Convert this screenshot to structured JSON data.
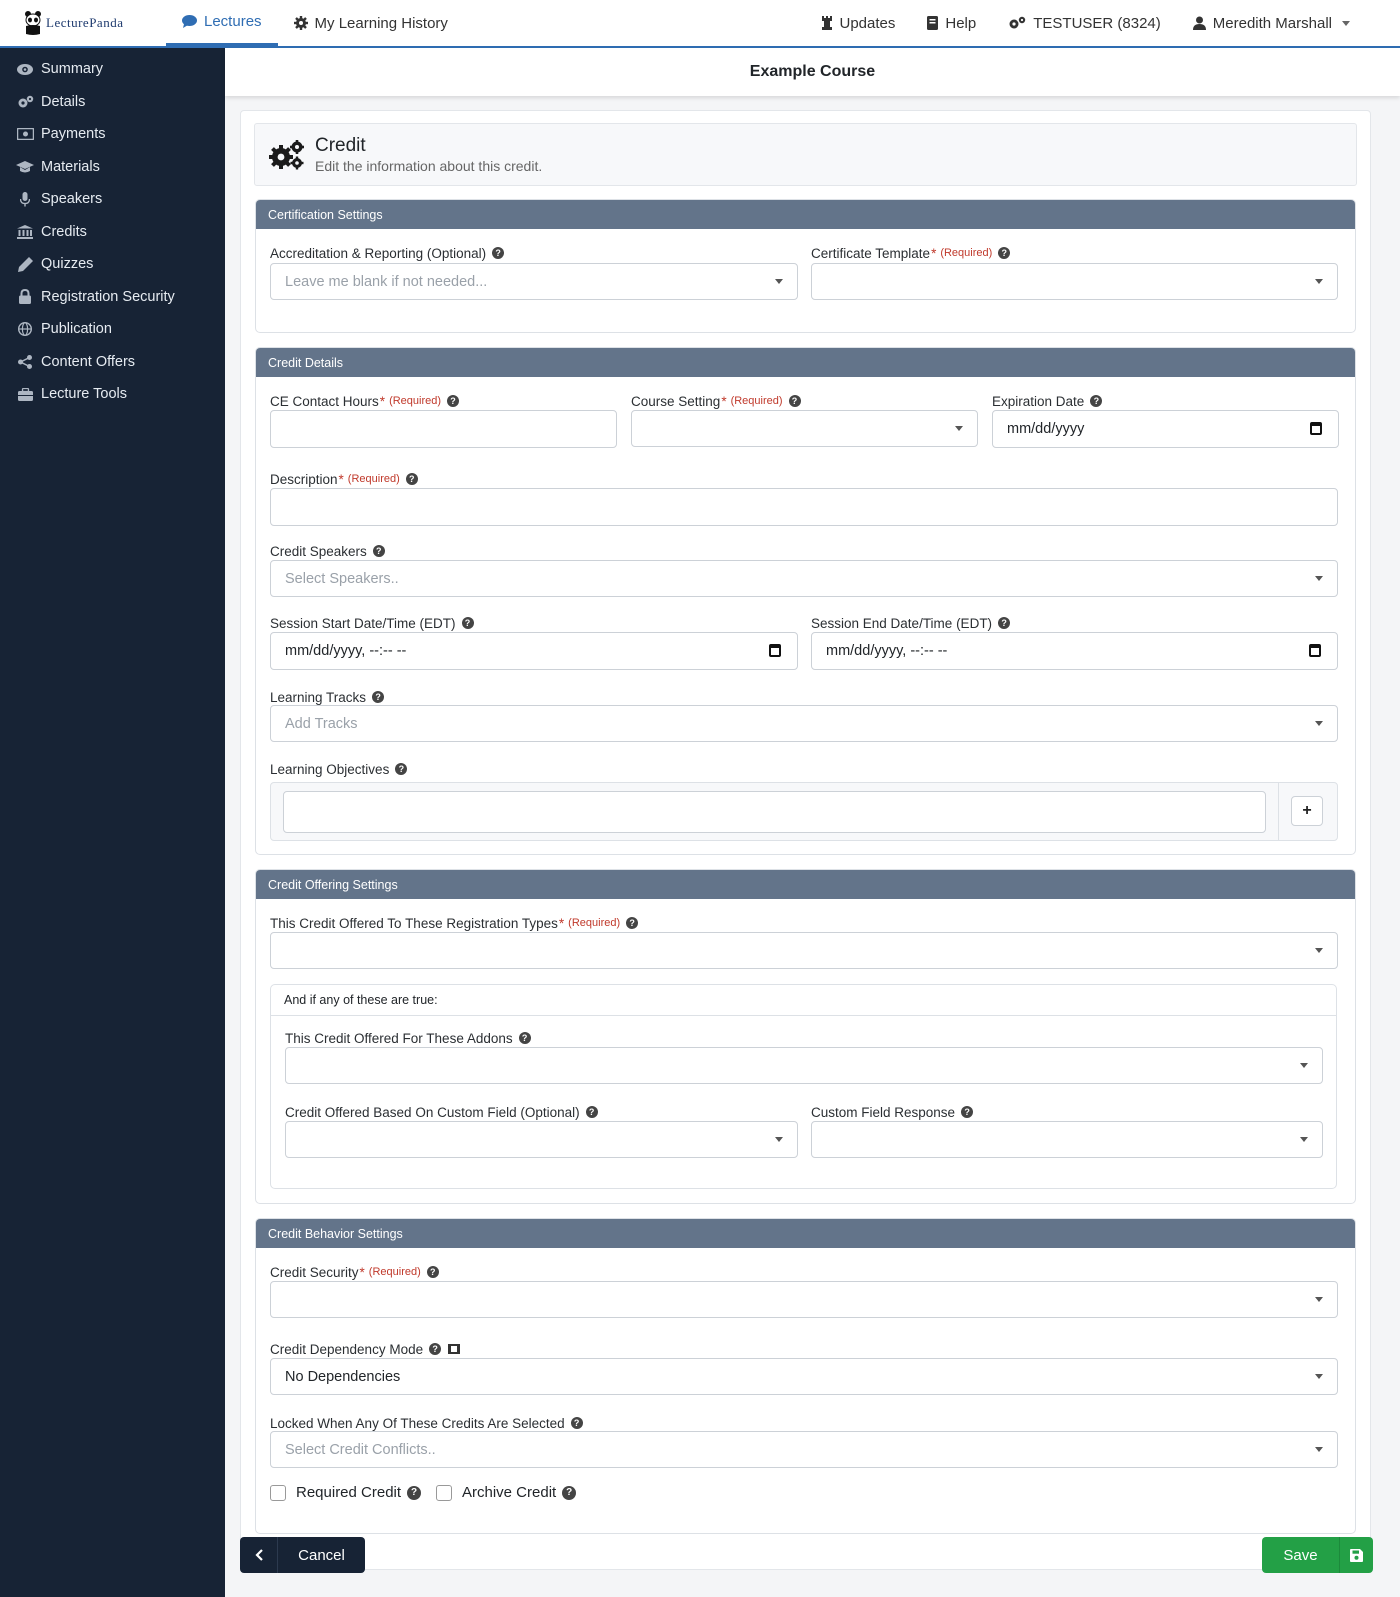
{
  "brand": {
    "name": "LecturePanda"
  },
  "topnav": {
    "lectures": "Lectures",
    "history": "My Learning History",
    "updates": "Updates",
    "help": "Help",
    "org": "TESTUSER (8324)",
    "user": "Meredith Marshall"
  },
  "sidebar": {
    "items": [
      {
        "label": "Summary",
        "icon": "eye-icon"
      },
      {
        "label": "Details",
        "icon": "cogs-icon"
      },
      {
        "label": "Payments",
        "icon": "money-icon"
      },
      {
        "label": "Materials",
        "icon": "graduation-cap-icon"
      },
      {
        "label": "Speakers",
        "icon": "microphone-icon"
      },
      {
        "label": "Credits",
        "icon": "university-icon"
      },
      {
        "label": "Quizzes",
        "icon": "pencil-icon"
      },
      {
        "label": "Registration Security",
        "icon": "lock-icon"
      },
      {
        "label": "Publication",
        "icon": "globe-icon"
      },
      {
        "label": "Content Offers",
        "icon": "share-icon"
      },
      {
        "label": "Lecture Tools",
        "icon": "briefcase-icon"
      }
    ]
  },
  "page": {
    "course_title": "Example Course"
  },
  "header": {
    "title": "Credit",
    "subtitle": "Edit the information about this credit."
  },
  "certification": {
    "section_title": "Certification Settings",
    "accreditation_label": "Accreditation & Reporting (Optional)",
    "accreditation_placeholder": "Leave me blank if not needed...",
    "template_label": "Certificate Template",
    "required_text": "(Required)"
  },
  "details": {
    "section_title": "Credit Details",
    "ce_hours_label": "CE Contact Hours",
    "course_setting_label": "Course Setting",
    "expiration_label": "Expiration Date",
    "expiration_value": "mm/dd/yyyy",
    "description_label": "Description",
    "speakers_label": "Credit Speakers",
    "speakers_placeholder": "Select Speakers..",
    "session_start_label": "Session Start Date/Time (EDT)",
    "session_start_value": "mm/dd/yyyy, --:-- --",
    "session_end_label": "Session End Date/Time (EDT)",
    "session_end_value": "mm/dd/yyyy, --:-- --",
    "tracks_label": "Learning Tracks",
    "tracks_placeholder": "Add Tracks",
    "objectives_label": "Learning Objectives"
  },
  "offering": {
    "section_title": "Credit Offering Settings",
    "registration_types_label": "This Credit Offered To These Registration Types",
    "conditions_title": "And if any of these are true:",
    "addons_label": "This Credit Offered For These Addons",
    "custom_field_label": "Credit Offered Based On Custom Field (Optional)",
    "custom_response_label": "Custom Field Response"
  },
  "behavior": {
    "section_title": "Credit Behavior Settings",
    "security_label": "Credit Security",
    "dependency_label": "Credit Dependency Mode",
    "dependency_value": "No Dependencies",
    "locked_label": "Locked When Any Of These Credits Are Selected",
    "locked_placeholder": "Select Credit Conflicts..",
    "required_credit": "Required Credit",
    "archive_credit": "Archive Credit"
  },
  "actions": {
    "cancel": "Cancel",
    "save": "Save"
  },
  "colors": {
    "primary": "#2f6db3",
    "sidebar": "#172335",
    "section_head": "#63748a",
    "save": "#23a046",
    "required": "#c0392b"
  }
}
